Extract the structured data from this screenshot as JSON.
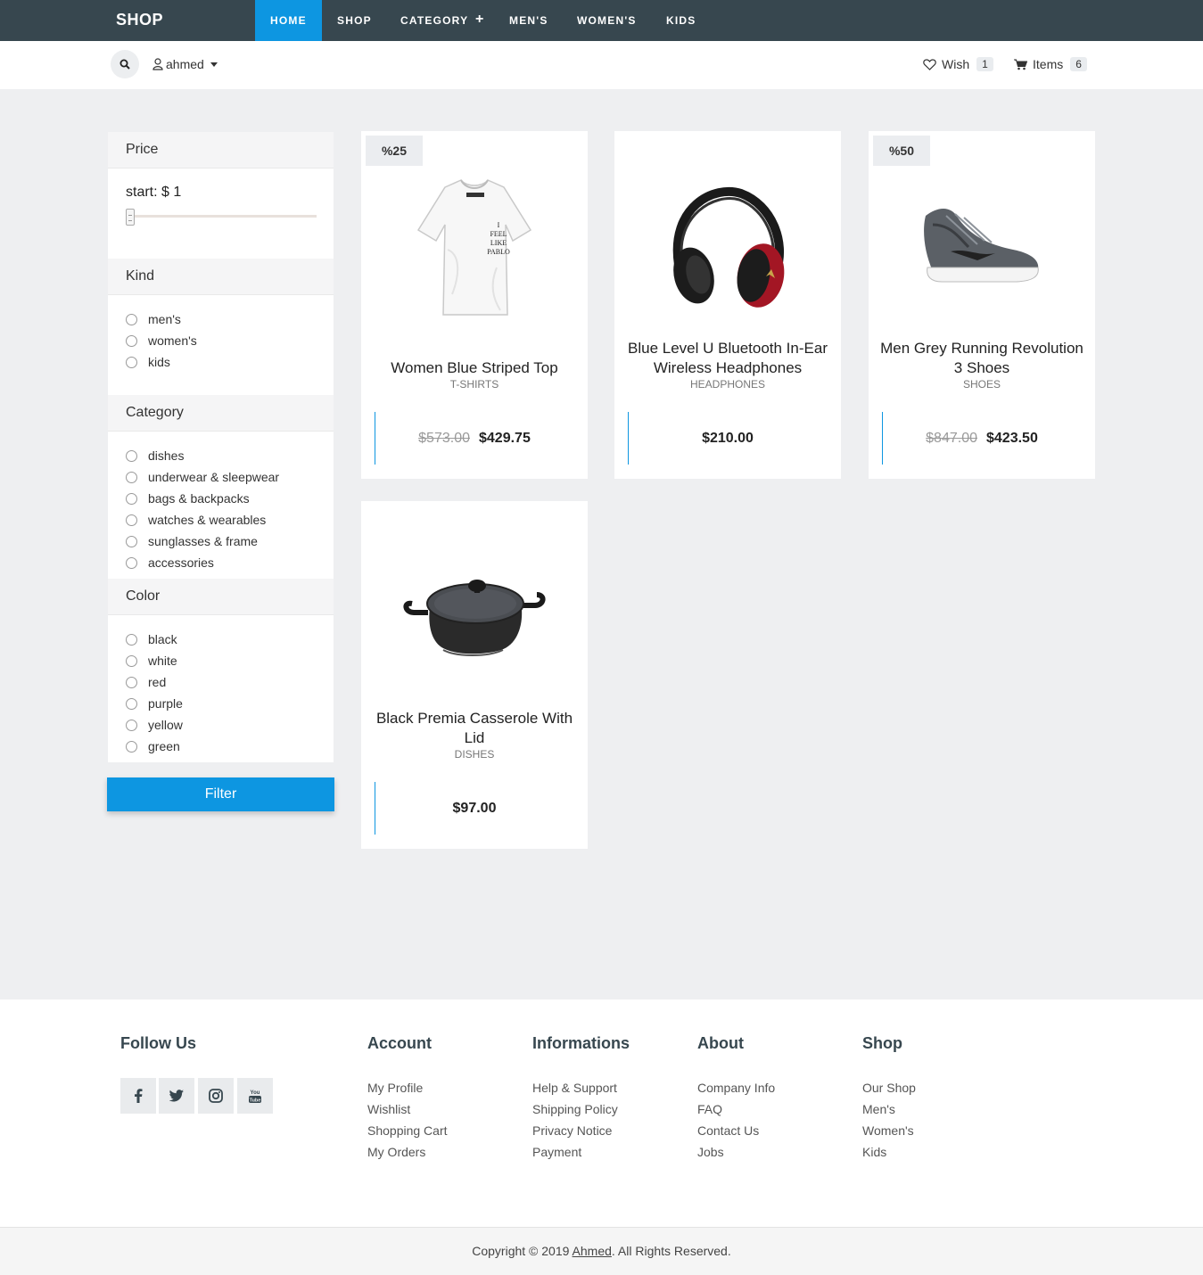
{
  "nav": {
    "brand": "SHOP",
    "items": [
      {
        "label": "HOME"
      },
      {
        "label": "SHOP"
      },
      {
        "label": "CATEGORY"
      },
      {
        "label": "MEN'S"
      },
      {
        "label": "WOMEN'S"
      },
      {
        "label": "KIDS"
      }
    ],
    "category_plus": "+"
  },
  "subheader": {
    "user": "ahmed",
    "wish_label": "Wish",
    "wish_count": "1",
    "items_label": "Items",
    "items_count": "6"
  },
  "sidebar": {
    "price_heading": "Price",
    "price_label": "start: $ 1",
    "kind_heading": "Kind",
    "kinds": [
      "men's",
      "women's",
      "kids"
    ],
    "category_heading": "Category",
    "categories": [
      "dishes",
      "underwear & sleepwear",
      "bags & backpacks",
      "watches & wearables",
      "sunglasses & frame",
      "accessories"
    ],
    "color_heading": "Color",
    "colors": [
      "black",
      "white",
      "red",
      "purple",
      "yellow",
      "green"
    ],
    "filter_label": "Filter"
  },
  "products": [
    {
      "discount": "%25",
      "title": "Women Blue Striped Top",
      "category": "T-SHIRTS",
      "old_price": "$573.00",
      "price": "$429.75"
    },
    {
      "discount": "",
      "title": "Blue Level U Bluetooth In-Ear Wireless Headphones",
      "category": "HEADPHONES",
      "old_price": "",
      "price": "$210.00"
    },
    {
      "discount": "%50",
      "title": "Men Grey Running Revolution 3 Shoes",
      "category": "SHOES",
      "old_price": "$847.00",
      "price": "$423.50"
    },
    {
      "discount": "",
      "title": "Black Premia Casserole With Lid",
      "category": "DISHES",
      "old_price": "",
      "price": "$97.00"
    }
  ],
  "tshirt_print": [
    "I",
    "FEEL",
    "LIKE",
    "PABLO"
  ],
  "footer": {
    "follow": "Follow Us",
    "youtube_text": [
      "You",
      "Tube"
    ],
    "columns": [
      {
        "heading": "Account",
        "links": [
          "My Profile",
          "Wishlist",
          "Shopping Cart",
          "My Orders"
        ]
      },
      {
        "heading": "Informations",
        "links": [
          "Help & Support",
          "Shipping Policy",
          "Privacy Notice",
          "Payment"
        ]
      },
      {
        "heading": "About",
        "links": [
          "Company Info",
          "FAQ",
          "Contact Us",
          "Jobs"
        ]
      },
      {
        "heading": "Shop",
        "links": [
          "Our Shop",
          "Men's",
          "Women's",
          "Kids"
        ]
      }
    ],
    "copyright_prefix": "Copyright © 2019",
    "copyright_name": "Ahmed",
    "copyright_suffix": ". All Rights Reserved."
  },
  "colors": {
    "nav_bg": "#37474f",
    "accent": "#0d96e1",
    "page_bg": "#eeeff1"
  },
  "icons": [
    "search-icon",
    "user-icon",
    "heart-icon",
    "cart-icon",
    "facebook-icon",
    "twitter-icon",
    "instagram-icon",
    "youtube-icon"
  ]
}
